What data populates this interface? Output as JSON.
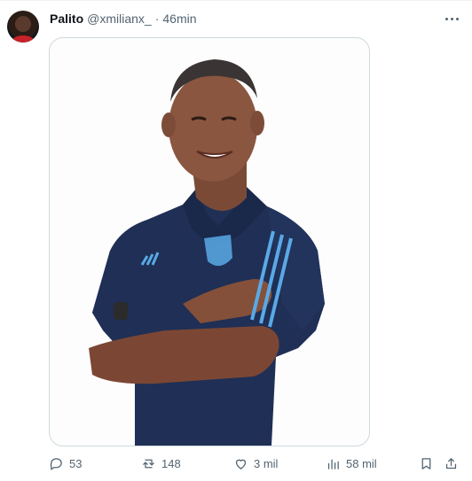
{
  "post": {
    "author": {
      "name": "Palito",
      "handle": "@xmilianx_",
      "separator": "·",
      "time": "46min"
    },
    "media": {
      "subject": "man-in-navy-argentina-polo"
    },
    "actions": {
      "replies": "53",
      "reposts": "148",
      "likes": "3 mil",
      "views": "58 mil"
    }
  },
  "colors": {
    "text_primary": "#0f1419",
    "text_secondary": "#536471",
    "border": "#cfd9de",
    "shirt_navy": "#1f2f55",
    "stripe_blue": "#5aa9e6"
  }
}
